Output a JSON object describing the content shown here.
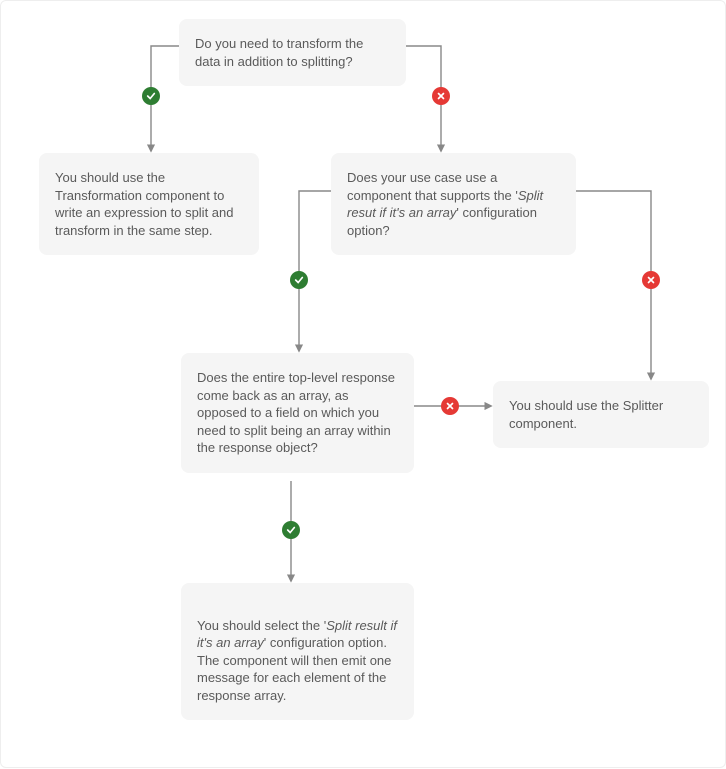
{
  "chart_data": {
    "type": "flowchart",
    "nodes": [
      {
        "id": "q1",
        "kind": "decision",
        "text": "Do you need to transform the data in addition to splitting?"
      },
      {
        "id": "a1",
        "kind": "terminal",
        "text": "You should use the Transformation component to write an expression to split and transform in the same step."
      },
      {
        "id": "q2",
        "kind": "decision",
        "text_pre": "Does your use case use a component that supports the '",
        "text_it": "Split resut if it's an array",
        "text_post": "' configuration option?"
      },
      {
        "id": "q3",
        "kind": "decision",
        "text": "Does the entire top-level response come back as an array, as opposed to a field on which you need to split being an array within the response object?"
      },
      {
        "id": "a2",
        "kind": "terminal",
        "text": "You should use the Splitter component."
      },
      {
        "id": "a3",
        "kind": "terminal",
        "text_pre": "You should select the '",
        "text_it": "Split result if it's an array",
        "text_post": "' configuration option.\nThe component will then emit one message for each element of the response array."
      }
    ],
    "edges": [
      {
        "from": "q1",
        "to": "a1",
        "label": "yes"
      },
      {
        "from": "q1",
        "to": "q2",
        "label": "no"
      },
      {
        "from": "q2",
        "to": "q3",
        "label": "yes"
      },
      {
        "from": "q2",
        "to": "a2",
        "label": "no"
      },
      {
        "from": "q3",
        "to": "a3",
        "label": "yes"
      },
      {
        "from": "q3",
        "to": "a2",
        "label": "no"
      }
    ]
  }
}
